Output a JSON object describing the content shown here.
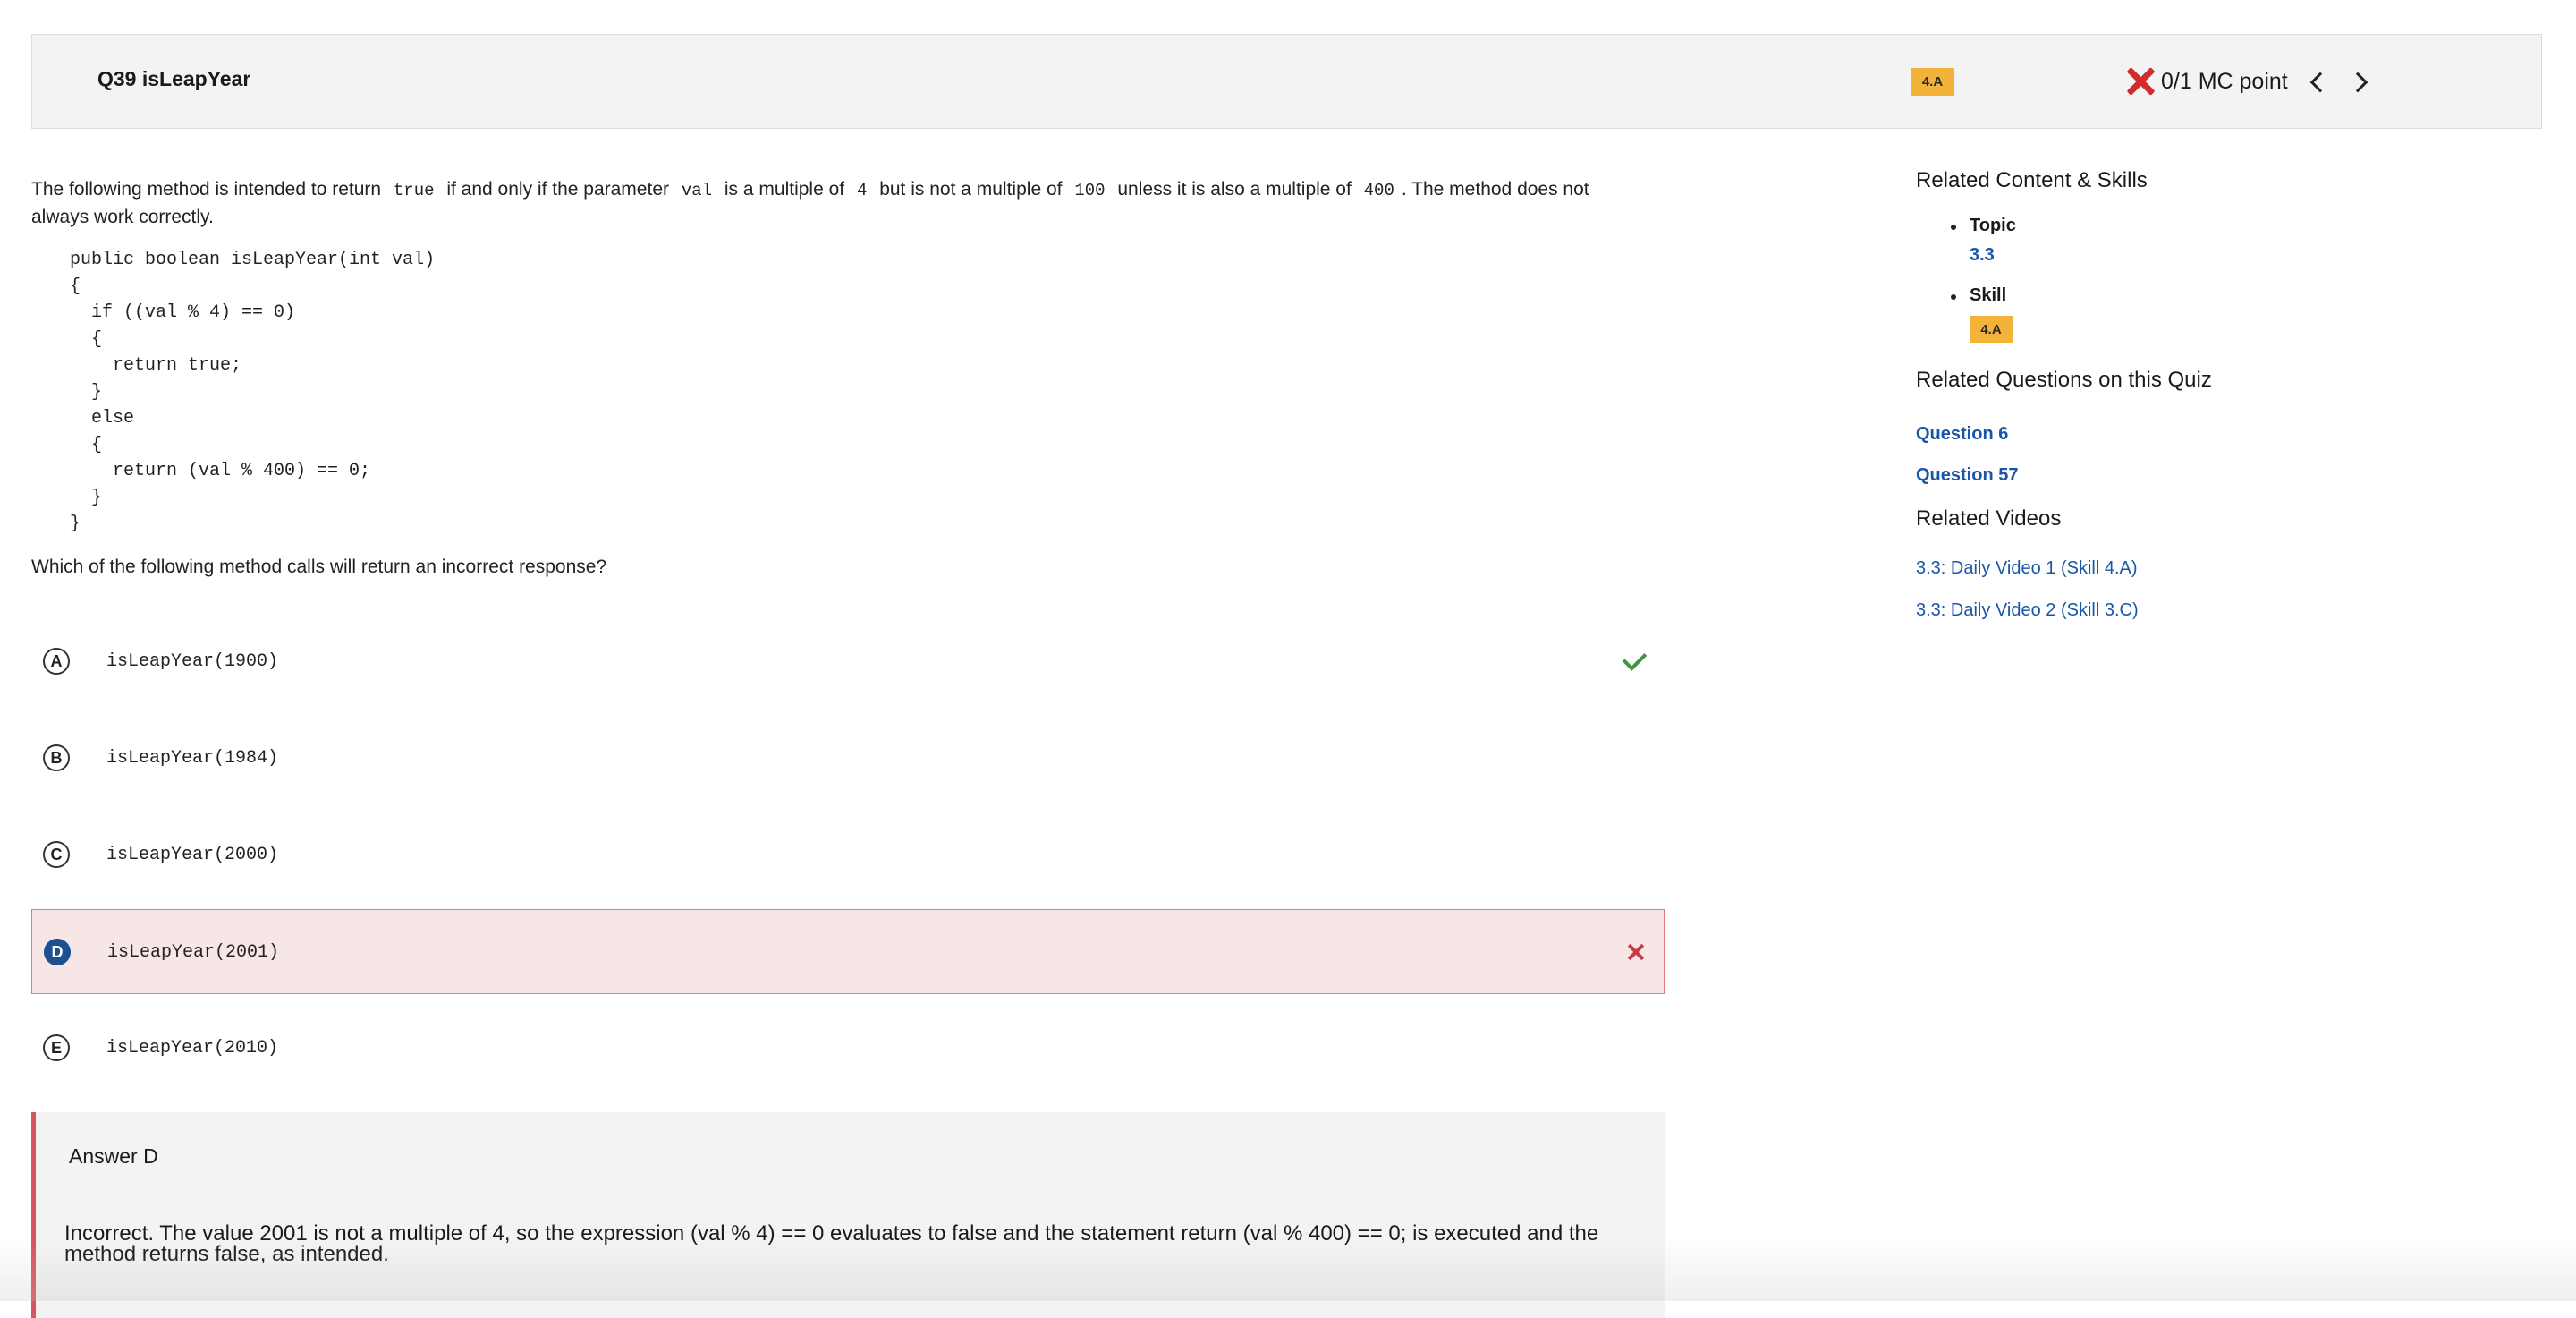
{
  "header": {
    "title": "Q39 isLeapYear",
    "skill_badge": "4.A",
    "score": "0/1 MC point"
  },
  "prompt": {
    "parts": [
      "The following method is intended to return ",
      "true",
      " if and only if the parameter ",
      "val",
      " is a multiple of ",
      "4",
      " but is not a multiple of ",
      "100",
      " unless it is also a multiple of ",
      "400",
      ". The method does not always work correctly."
    ],
    "code": "public boolean isLeapYear(int val)\n{\n  if ((val % 4) == 0)\n  {\n    return true;\n  }\n  else\n  {\n    return (val % 400) == 0;\n  }\n}",
    "question": "Which of the following method calls will return an incorrect response?"
  },
  "choices": [
    {
      "letter": "A",
      "code": "isLeapYear(1900)"
    },
    {
      "letter": "B",
      "code": "isLeapYear(1984)"
    },
    {
      "letter": "C",
      "code": "isLeapYear(2000)"
    },
    {
      "letter": "D",
      "code": "isLeapYear(2001)"
    },
    {
      "letter": "E",
      "code": "isLeapYear(2010)"
    }
  ],
  "answer": {
    "title": "Answer D",
    "explanation": "Incorrect. The value 2001 is not a multiple of 4, so the expression (val % 4) == 0 evaluates to false and the statement return (val % 400) == 0; is executed and the method returns false, as intended."
  },
  "sidebar": {
    "related_heading": "Related Content & Skills",
    "topic_label": "Topic",
    "topic_value": "3.3",
    "skill_label": "Skill",
    "skill_value": "4.A",
    "questions_heading": "Related Questions on this Quiz",
    "questions": [
      "Question 6",
      "Question 57"
    ],
    "videos_heading": "Related Videos",
    "videos": [
      "3.3: Daily Video 1 (Skill 4.A)",
      "3.3: Daily Video 2 (Skill 3.C)"
    ]
  },
  "colors": {
    "badge": "#f3b23a",
    "link": "#1a56a8",
    "incorrect": "#d22b2b",
    "correct": "#3c9a3c",
    "selected_bg": "#f6e6e6",
    "selected_letter": "#1d4f91"
  },
  "icons": {
    "score_status": "x-mark-icon",
    "correct_marker": "checkmark-icon",
    "incorrect_marker": "x-mark-icon",
    "prev": "chevron-left-icon",
    "next": "chevron-right-icon"
  }
}
